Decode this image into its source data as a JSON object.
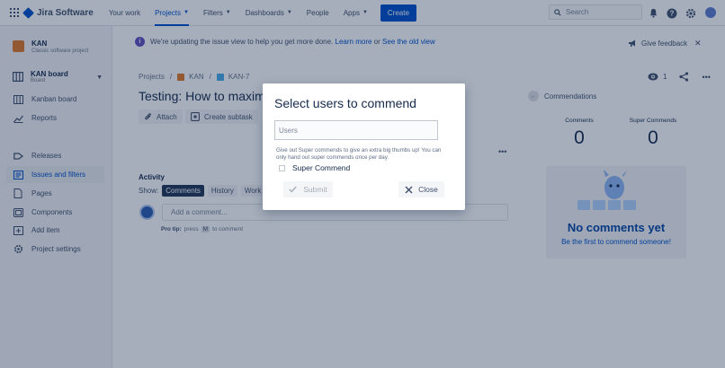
{
  "topnav": {
    "logo_text": "Jira Software",
    "items": [
      {
        "label": "Your work"
      },
      {
        "label": "Projects"
      },
      {
        "label": "Filters"
      },
      {
        "label": "Dashboards"
      },
      {
        "label": "People"
      },
      {
        "label": "Apps"
      }
    ],
    "create_label": "Create",
    "search_placeholder": "Search"
  },
  "sidebar": {
    "project_name": "KAN",
    "project_type": "Classic software project",
    "board_name": "KAN board",
    "board_sub": "Board",
    "items": [
      {
        "label": "Kanban board",
        "icon": "kanban-icon"
      },
      {
        "label": "Reports",
        "icon": "reports-icon"
      },
      {
        "label": "Releases",
        "icon": "releases-icon"
      },
      {
        "label": "Issues and filters",
        "icon": "issues-icon"
      },
      {
        "label": "Pages",
        "icon": "pages-icon"
      },
      {
        "label": "Components",
        "icon": "components-icon"
      },
      {
        "label": "Add item",
        "icon": "add-item-icon"
      },
      {
        "label": "Project settings",
        "icon": "settings-icon"
      }
    ]
  },
  "banner": {
    "text": "We're updating the issue view to help you get more done.",
    "learn_more": "Learn more",
    "or": "or",
    "old_view": "See the old view",
    "feedback": "Give feedback"
  },
  "breadcrumbs": {
    "projects": "Projects",
    "project": "KAN",
    "issue": "KAN-7"
  },
  "issue": {
    "title": "Testing: How to maximize",
    "attach": "Attach",
    "create_subtask": "Create subtask"
  },
  "activity": {
    "label": "Activity",
    "show": "Show:",
    "tabs": [
      {
        "label": "Comments"
      },
      {
        "label": "History"
      },
      {
        "label": "Work lo"
      }
    ],
    "comment_placeholder": "Add a comment...",
    "protip_label": "Pro tip:",
    "protip_press": "press",
    "protip_key": "M",
    "protip_rest": "to comment"
  },
  "right_panel": {
    "watch_count": "1",
    "commendations_label": "Commendations",
    "comments_label": "Comments",
    "comments_value": "0",
    "super_label": "Super Commends",
    "super_value": "0",
    "no_comments": "No comments yet",
    "be_first": "Be the first to commend someone!"
  },
  "modal": {
    "title": "Select users to commend",
    "users_placeholder": "Users",
    "help_text": "Give out Super commends to give an extra big thumbs up! You can only hand out super commends once per day.",
    "super_label": "Super Commend",
    "submit_label": "Submit",
    "close_label": "Close"
  }
}
